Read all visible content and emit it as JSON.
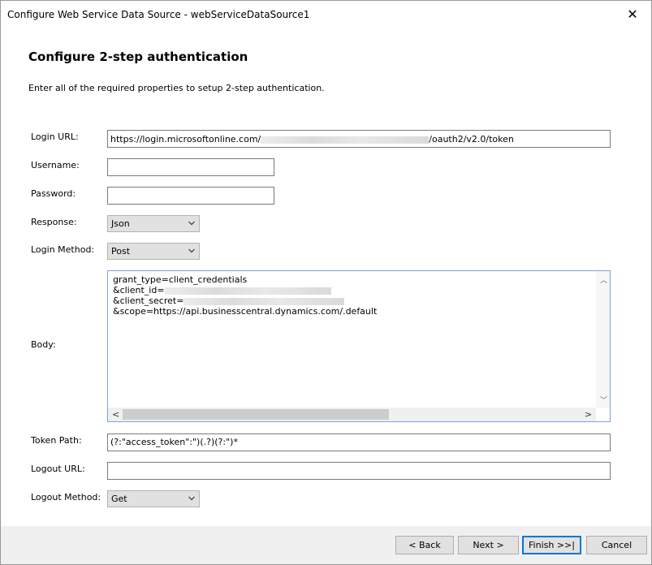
{
  "window": {
    "title": "Configure Web Service Data Source - webServiceDataSource1",
    "close_glyph": "✕"
  },
  "page": {
    "heading": "Configure 2-step authentication",
    "description": "Enter all of the required properties to setup 2-step authentication."
  },
  "form": {
    "login_url": {
      "label": "Login URL:",
      "value_prefix": "https://login.microsoftonline.com/",
      "value_suffix": "/oauth2/v2.0/token"
    },
    "username": {
      "label": "Username:",
      "value": ""
    },
    "password": {
      "label": "Password:",
      "value": ""
    },
    "response": {
      "label": "Response:",
      "value": "Json"
    },
    "login_method": {
      "label": "Login Method:",
      "value": "Post"
    },
    "body": {
      "label": "Body:",
      "line1": "grant_type=client_credentials",
      "line2": "&client_id=",
      "line3": "&client_secret=",
      "line4": "&scope=https://api.businesscentral.dynamics.com/.default"
    },
    "token_path": {
      "label": "Token Path:",
      "value": "(?:\"access_token\":\")(.?)(?:\")*"
    },
    "logout_url": {
      "label": "Logout URL:",
      "value": ""
    },
    "logout_method": {
      "label": "Logout Method:",
      "value": "Get"
    }
  },
  "buttons": {
    "back": "< Back",
    "next": "Next >",
    "finish": "Finish >>|",
    "cancel": "Cancel"
  },
  "icons": {
    "dropdown": "chevron-down-icon",
    "close": "close-icon"
  }
}
